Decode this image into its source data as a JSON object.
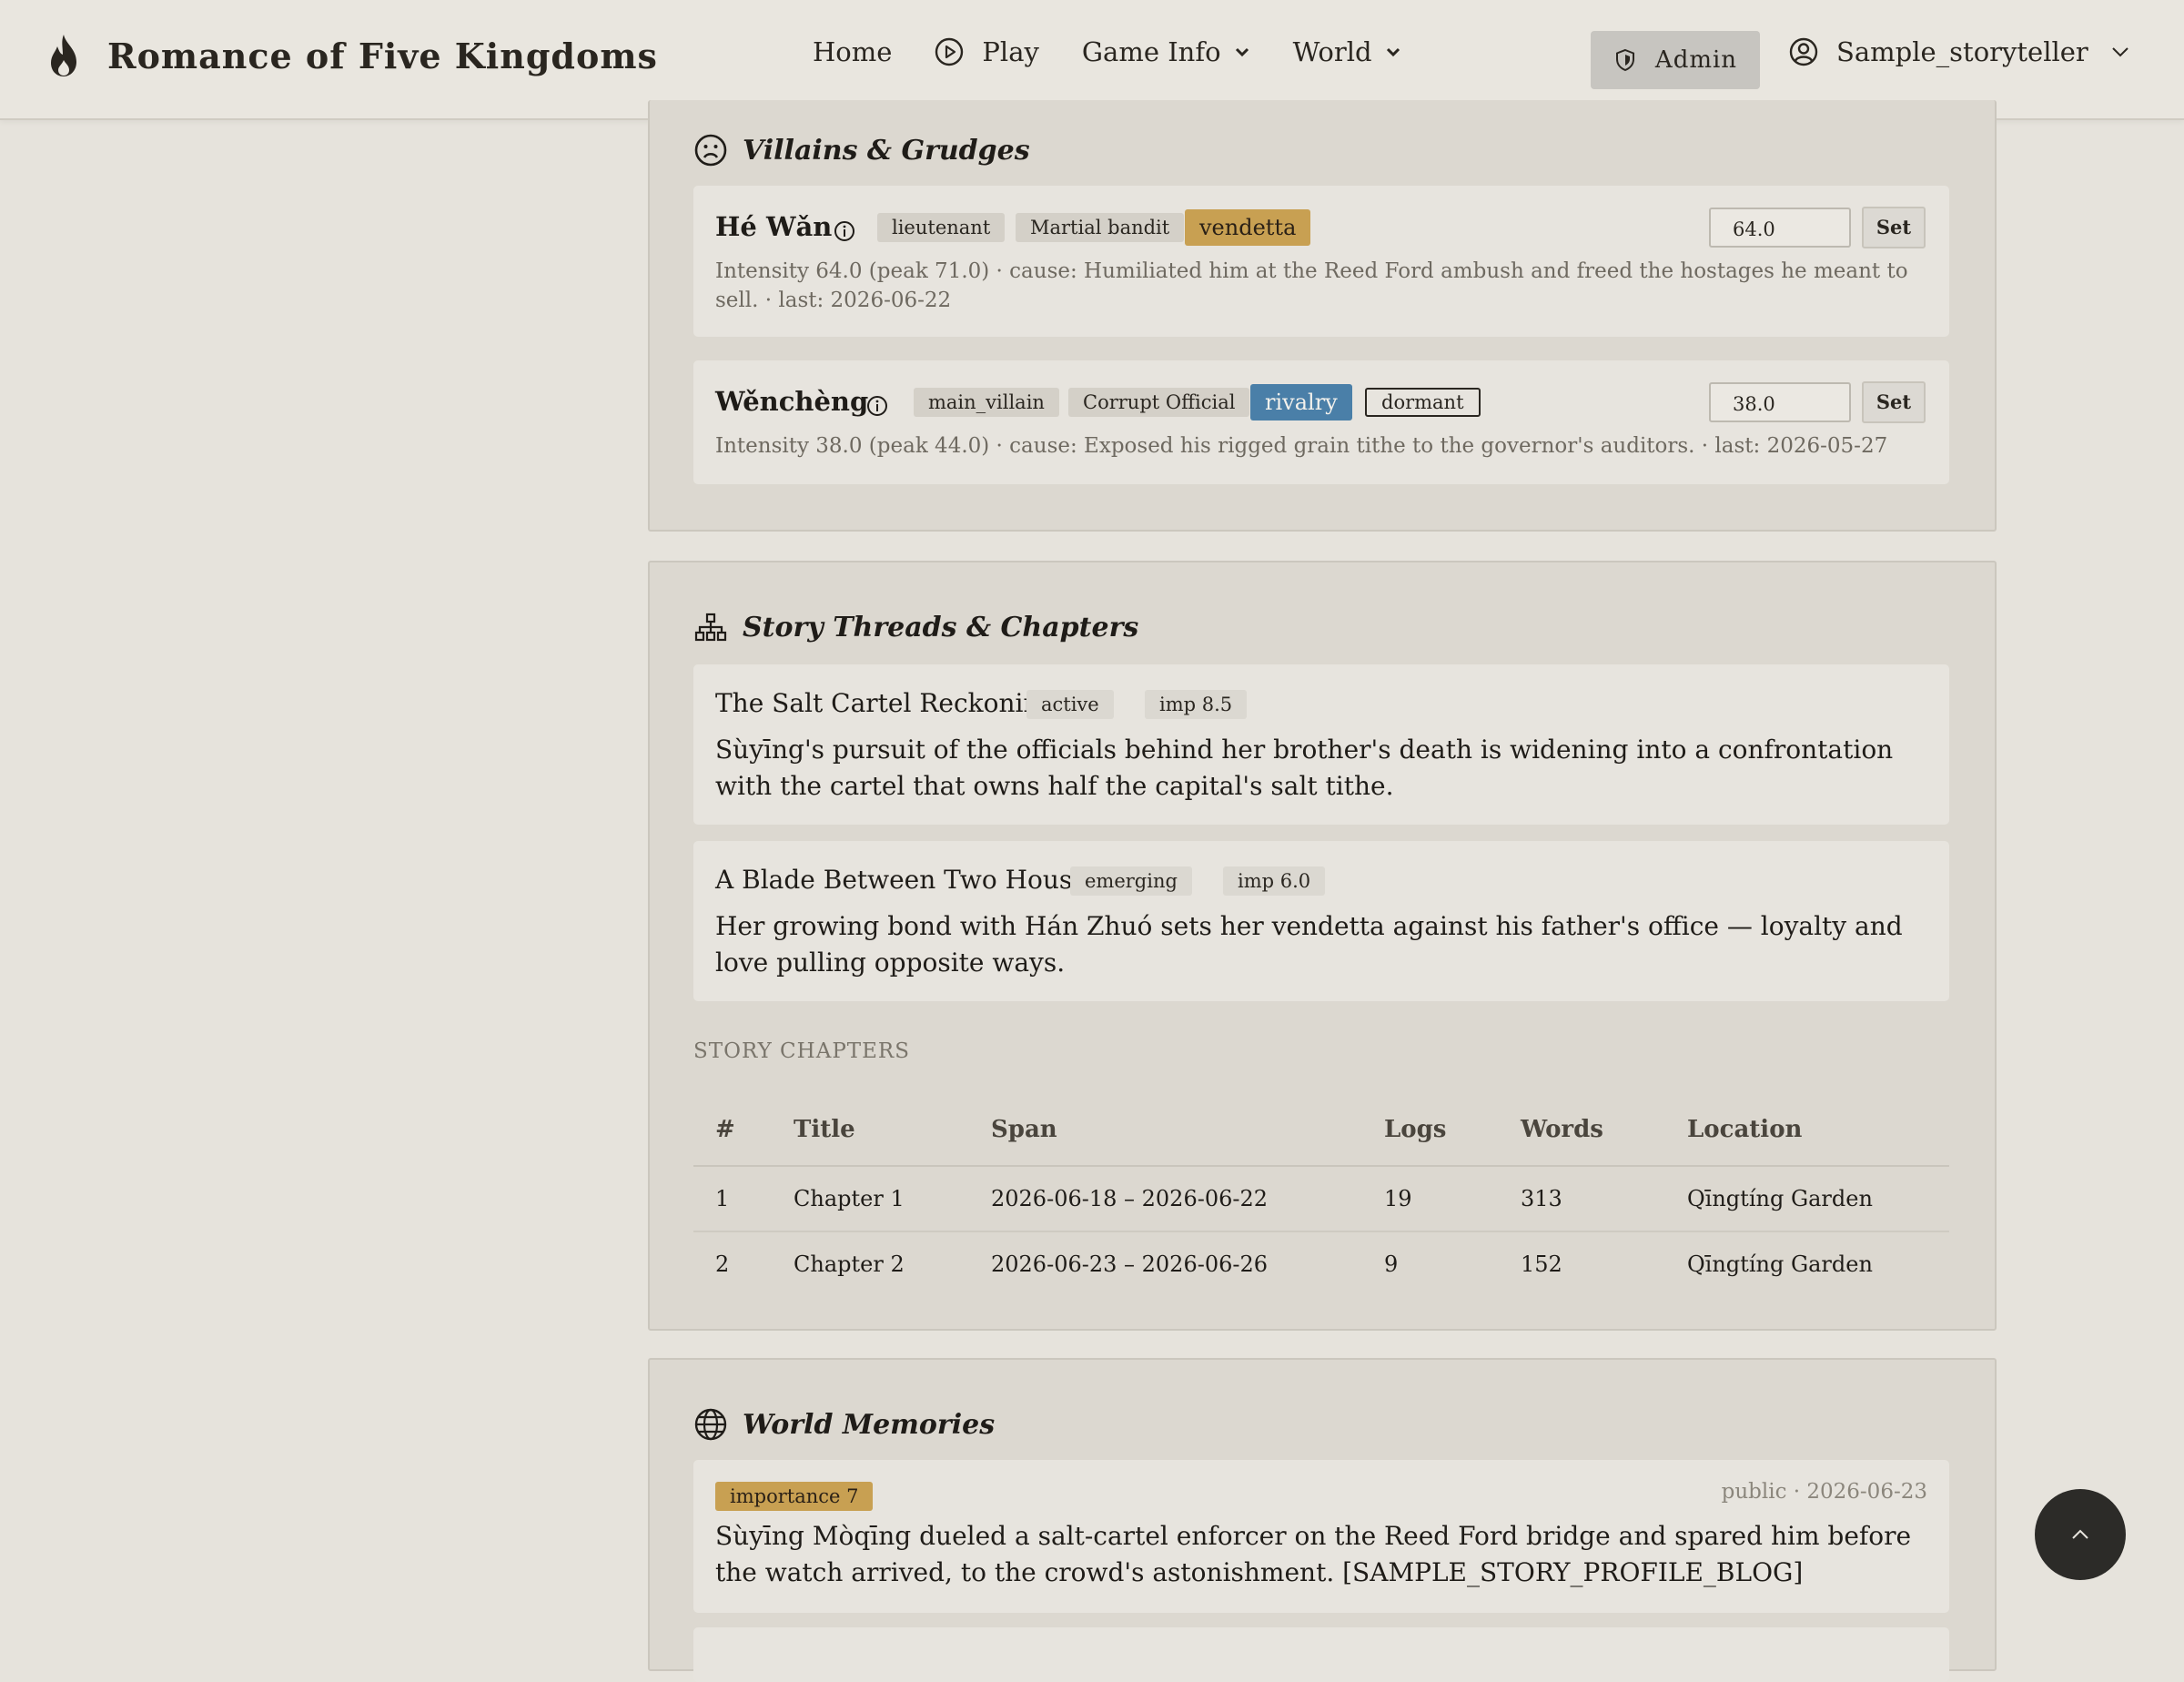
{
  "nav": {
    "brand_title": "Romance of Five Kingdoms",
    "links": {
      "home": "Home",
      "play": "Play",
      "game_info": "Game Info",
      "world": "World"
    },
    "admin_label": "Admin",
    "username": "Sample_storyteller"
  },
  "villains": {
    "title": "Villains & Grudges",
    "items": [
      {
        "name": "Hé Wǎn",
        "tags": [
          "lieutenant",
          "Martial bandit"
        ],
        "grudge_type": "vendetta",
        "intensity_value": "64.0",
        "set_label": "Set",
        "meta": "Intensity 64.0 (peak 71.0) · cause: Humiliated him at the Reed Ford ambush and freed the hostages he meant to sell. · last: 2026-06-22"
      },
      {
        "name": "Wěnchèng",
        "tags": [
          "main_villain",
          "Corrupt Official"
        ],
        "grudge_type": "rivalry",
        "status": "dormant",
        "intensity_value": "38.0",
        "set_label": "Set",
        "meta": "Intensity 38.0 (peak 44.0) · cause: Exposed his rigged grain tithe to the governor's auditors. · last: 2026-05-27"
      }
    ]
  },
  "threads": {
    "title": "Story Threads & Chapters",
    "items": [
      {
        "title": "The Salt Cartel Reckoning",
        "status": "active",
        "importance": "imp 8.5",
        "description": "Sùyīng's pursuit of the officials behind her brother's death is widening into a confrontation with the cartel that owns half the capital's salt tithe."
      },
      {
        "title": "A Blade Between Two Houses",
        "status": "emerging",
        "importance": "imp 6.0",
        "description": "Her growing bond with Hán Zhuó sets her vendetta against his father's office — loyalty and love pulling opposite ways."
      }
    ],
    "chapters_heading": "STORY CHAPTERS",
    "chapter_columns": [
      "#",
      "Title",
      "Span",
      "Logs",
      "Words",
      "Location"
    ],
    "chapters": [
      {
        "num": "1",
        "title": "Chapter 1",
        "span": "2026-06-18 – 2026-06-22",
        "logs": "19",
        "words": "313",
        "location": "Qīngtíng Garden"
      },
      {
        "num": "2",
        "title": "Chapter 2",
        "span": "2026-06-23 – 2026-06-26",
        "logs": "9",
        "words": "152",
        "location": "Qīngtíng Garden"
      }
    ]
  },
  "memories": {
    "title": "World Memories",
    "items": [
      {
        "importance": "importance 7",
        "meta": "public · 2026-06-23",
        "text": "Sùyīng Mòqīng dueled a salt-cartel enforcer on the Reed Ford bridge and spared him before the watch arrived, to the crowd's astonishment. [SAMPLE_STORY_PROFILE_BLOG]"
      }
    ]
  },
  "colors": {
    "background": "#e6e3dc",
    "vendetta": "#c8a052",
    "rivalry": "#4a7fa8",
    "importance_badge": "#c8a052",
    "scroll_top_button": "#2c2b28"
  },
  "icons": {
    "brand": "flame-icon",
    "play": "play-circle-icon",
    "admin": "shield-icon",
    "user": "user-circle-icon",
    "villains": "frown-face-icon",
    "threads": "sitemap-icon",
    "memories": "globe-icon",
    "info": "info-icon",
    "scroll_top": "chevron-up-icon"
  }
}
